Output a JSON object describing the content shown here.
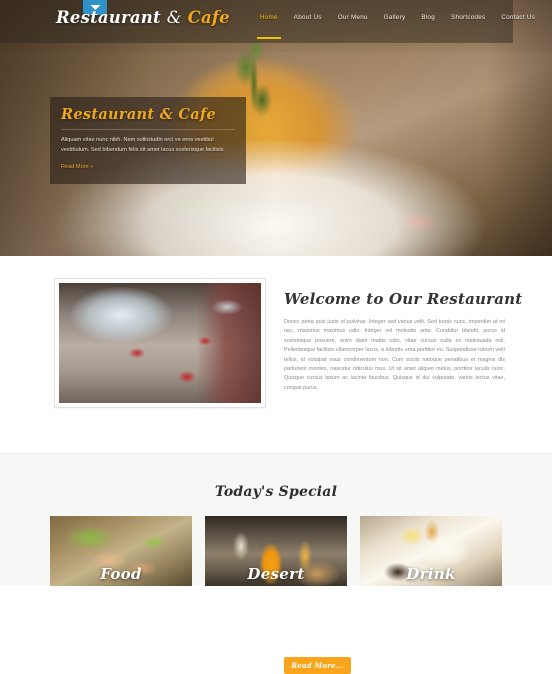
{
  "header": {
    "logo": {
      "part1": "Restaurant",
      "amp": "&",
      "part2": "Cafe"
    },
    "badge_icon": "chevron-down-icon",
    "nav": [
      {
        "label": "Home",
        "active": true
      },
      {
        "label": "About Us",
        "active": false
      },
      {
        "label": "Our Menu",
        "active": false
      },
      {
        "label": "Gallery",
        "active": false
      },
      {
        "label": "Blog",
        "active": false
      },
      {
        "label": "Shortcodes",
        "active": false
      },
      {
        "label": "Contact Us",
        "active": false
      }
    ]
  },
  "hero": {
    "caption_title": "Restaurant & Cafe",
    "caption_text": "Aliquam vitae nunc nibh. Nam sollicitudin orci ve eros vestibul vestibulum. Sed bibendum felis sit amet lacus scelerisque facilisis",
    "read_more_label": "Read More »"
  },
  "welcome": {
    "title": "Welcome to Our Restaurant",
    "body": "Donec porta quis justo id pulvinar. Integer sed varius velit. Sed turpis nunc, imperdiet at mi nec, maximus maximus odio. Integer vel molestie ante. Curabitur blandit, purus id scelerisque posuere, enim diam mattis odio, vitae cursus nulla ex malesuada nisl. Pellentesque facilisis ullamcorper lacus, a lobortis urna porttitor eu. Suspendisse rutrum velit tellus, id volutpat risus condimentum non. Cum sociis natoque penatibus et magnis dis parturient montes, nascetur ridiculus mus. Ut sit amet aliquet metus, porttitor iaculis nunc. Quisque cursus ipsum ac lacinia faucibus. Quisque id dui vulputate, varius lectus vitae, congue purus.",
    "read_more_label": "Read More...",
    "photo_alt": "restaurant-interior-photo"
  },
  "specials": {
    "title": "Today's Special",
    "cards": [
      {
        "label": "Food"
      },
      {
        "label": "Desert"
      },
      {
        "label": "Drink"
      }
    ]
  },
  "colors": {
    "accent_orange": "#f8a51b",
    "logo_gold": "#f0a81e",
    "nav_active": "#f5c518",
    "badge_blue": "#2f93c9",
    "specials_bg": "#f7f7f5",
    "body_text": "#8b8b8b"
  }
}
